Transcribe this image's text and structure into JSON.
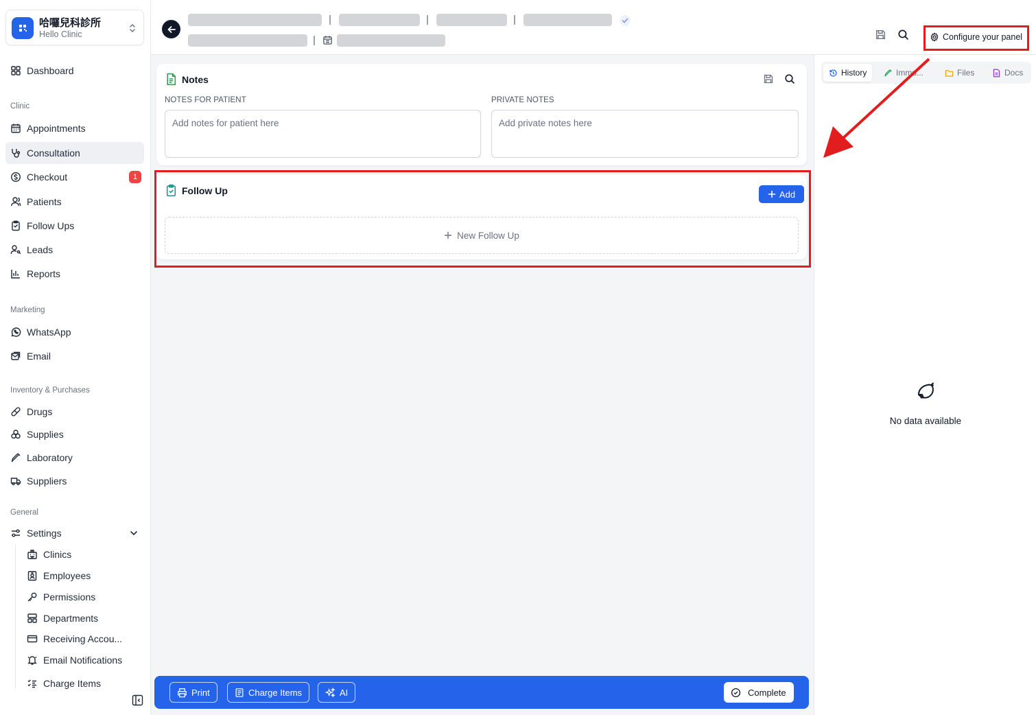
{
  "sidebar": {
    "clinic": {
      "name": "哈囉兒科診所",
      "subtitle": "Hello Clinic"
    },
    "dashboard": "Dashboard",
    "sections": {
      "clinic": "Clinic",
      "marketing": "Marketing",
      "inventory": "Inventory & Purchases",
      "general": "General"
    },
    "items": {
      "appointments": "Appointments",
      "consultation": "Consultation",
      "checkout": "Checkout",
      "checkout_badge": "1",
      "patients": "Patients",
      "follow_ups": "Follow Ups",
      "leads": "Leads",
      "reports": "Reports",
      "whatsapp": "WhatsApp",
      "email": "Email",
      "drugs": "Drugs",
      "supplies": "Supplies",
      "laboratory": "Laboratory",
      "suppliers": "Suppliers",
      "settings": "Settings"
    },
    "settings_children": {
      "clinics": "Clinics",
      "employees": "Employees",
      "permissions": "Permissions",
      "departments": "Departments",
      "receiving_accounts": "Receiving Accou...",
      "email_notifications": "Email Notifications",
      "charge_items": "Charge Items"
    }
  },
  "header": {
    "configure_label": "Configure your panel"
  },
  "notes": {
    "title": "Notes",
    "patient_label": "Notes for patient",
    "patient_placeholder": "Add notes for patient here",
    "private_label": "Private notes",
    "private_placeholder": "Add private notes here"
  },
  "follow_up": {
    "title": "Follow Up",
    "add_label": "Add",
    "new_label": "New Follow Up"
  },
  "right_panel": {
    "tabs": [
      "History",
      "Immu...",
      "Files",
      "Docs"
    ],
    "empty_text": "No data available"
  },
  "bottom_bar": {
    "print": "Print",
    "charge_items": "Charge Items",
    "ai": "AI",
    "complete": "Complete"
  },
  "colors": {
    "primary": "#2563eb",
    "highlight": "#e11d1d",
    "badge": "#ef4444",
    "notes_icon": "#16a34a",
    "follow_up_icon": "#0d9488"
  }
}
